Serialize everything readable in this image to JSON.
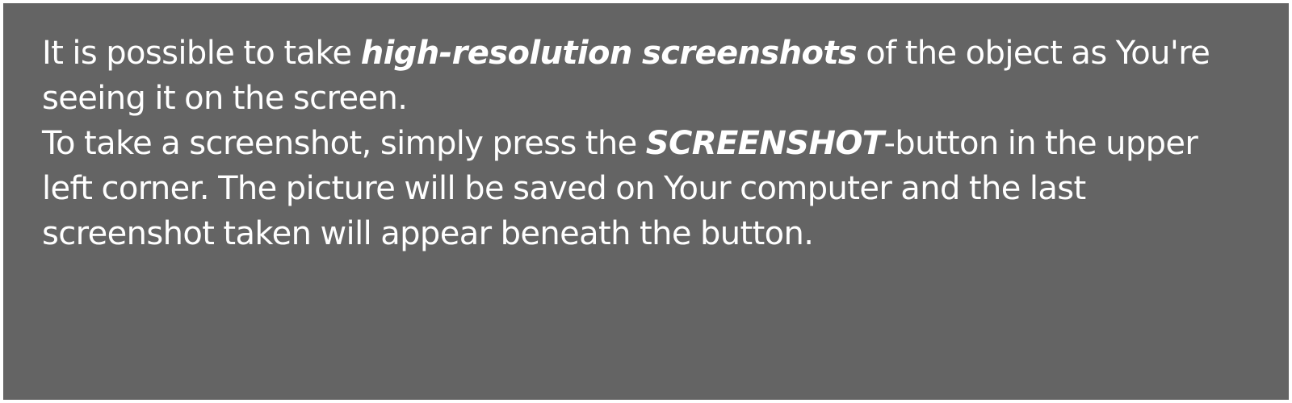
{
  "panel": {
    "background_color": "#646464",
    "text_color": "#ffffff",
    "paragraph1": {
      "before": "It is possible to take ",
      "emphasis": "high-resolution screenshots",
      "after": " of the object as You're seeing it on the screen."
    },
    "paragraph2": {
      "before": "To take a screenshot, simply press the ",
      "emphasis": "SCREENSHOT",
      "after": "-button in the upper left corner. The picture will be saved on Your computer and the last screenshot taken will appear beneath the button."
    }
  }
}
